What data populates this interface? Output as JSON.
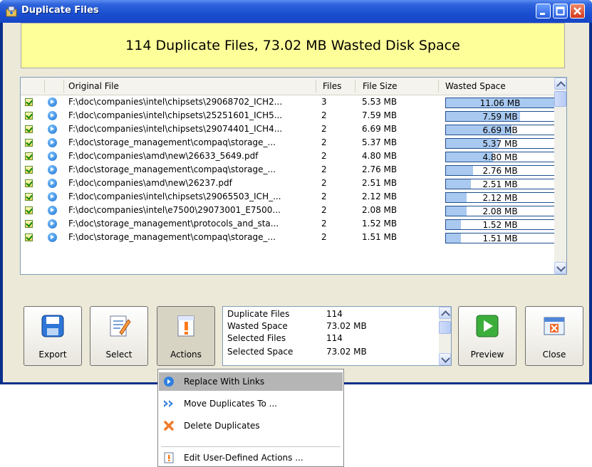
{
  "window": {
    "title": "Duplicate Files"
  },
  "summary": "114 Duplicate Files, 73.02 MB Wasted Disk Space",
  "columns": {
    "original_file": "Original File",
    "files": "Files",
    "file_size": "File Size",
    "wasted_space": "Wasted Space"
  },
  "rows": [
    {
      "file": "F:\\doc\\companies\\intel\\chipsets\\29068702_ICH2...",
      "files": "3",
      "size": "5.53 MB",
      "wasted": "11.06 MB",
      "fraction": 1.0
    },
    {
      "file": "F:\\doc\\companies\\intel\\chipsets\\25251601_ICH5...",
      "files": "2",
      "size": "7.59 MB",
      "wasted": "7.59 MB",
      "fraction": 0.686
    },
    {
      "file": "F:\\doc\\companies\\intel\\chipsets\\29074401_ICH4...",
      "files": "2",
      "size": "6.69 MB",
      "wasted": "6.69 MB",
      "fraction": 0.605
    },
    {
      "file": "F:\\doc\\storage_management\\compaq\\storage_...",
      "files": "2",
      "size": "5.37 MB",
      "wasted": "5.37 MB",
      "fraction": 0.486
    },
    {
      "file": "F:\\doc\\companies\\amd\\new\\26633_5649.pdf",
      "files": "2",
      "size": "4.80 MB",
      "wasted": "4.80 MB",
      "fraction": 0.434
    },
    {
      "file": "F:\\doc\\storage_management\\compaq\\storage_...",
      "files": "2",
      "size": "2.76 MB",
      "wasted": "2.76 MB",
      "fraction": 0.25
    },
    {
      "file": "F:\\doc\\companies\\amd\\new\\26237.pdf",
      "files": "2",
      "size": "2.51 MB",
      "wasted": "2.51 MB",
      "fraction": 0.227
    },
    {
      "file": "F:\\doc\\companies\\intel\\chipsets\\29065503_ICH_...",
      "files": "2",
      "size": "2.12 MB",
      "wasted": "2.12 MB",
      "fraction": 0.192
    },
    {
      "file": "F:\\doc\\companies\\intel\\e7500\\29073001_E7500...",
      "files": "2",
      "size": "2.08 MB",
      "wasted": "2.08 MB",
      "fraction": 0.188
    },
    {
      "file": "F:\\doc\\storage_management\\protocols_and_sta...",
      "files": "2",
      "size": "1.52 MB",
      "wasted": "1.52 MB",
      "fraction": 0.137
    },
    {
      "file": "F:\\doc\\storage_management\\compaq\\storage_...",
      "files": "2",
      "size": "1.51 MB",
      "wasted": "1.51 MB",
      "fraction": 0.137
    }
  ],
  "buttons": {
    "export": "Export",
    "select": "Select",
    "actions": "Actions",
    "preview": "Preview",
    "close": "Close"
  },
  "stats": [
    {
      "label": "Duplicate Files",
      "value": "114"
    },
    {
      "label": "Wasted Space",
      "value": "73.02 MB"
    },
    {
      "label": "Selected Files",
      "value": "114"
    },
    {
      "label": "Selected Space",
      "value": "73.02 MB"
    }
  ],
  "menu": {
    "items": [
      {
        "label": "Replace With Links",
        "icon": "replace-links-icon",
        "highlighted": true
      },
      {
        "label": "Move Duplicates To ...",
        "icon": "move-icon",
        "highlighted": false
      },
      {
        "label": "Delete Duplicates",
        "icon": "delete-icon",
        "highlighted": false
      },
      {
        "label": "Edit User-Defined Actions ...",
        "icon": "edit-actions-icon",
        "highlighted": false
      }
    ]
  },
  "colors": {
    "banner": "#ffff99",
    "bar_fill": "#a9c9f0",
    "titlebar": "#1a4fd0"
  }
}
